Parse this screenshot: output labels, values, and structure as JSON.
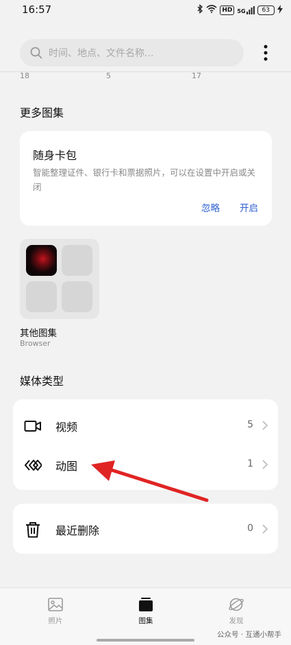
{
  "status": {
    "time": "16:57",
    "network": "5G",
    "hd": "HD",
    "battery": "63"
  },
  "search": {
    "placeholder": "时间、地点、文件名称..."
  },
  "scroll_counts": [
    "18",
    "5",
    "17"
  ],
  "more_albums": {
    "title": "更多图集",
    "wallet": {
      "title": "随身卡包",
      "description": "智能整理证件、银行卡和票据照片，可以在设置中开启或关闭",
      "ignore": "忽略",
      "enable": "开启"
    },
    "other": {
      "name": "其他图集",
      "sub": "Browser"
    }
  },
  "media_types": {
    "title": "媒体类型",
    "items": [
      {
        "label": "视频",
        "count": "5",
        "icon": "video-icon"
      },
      {
        "label": "动图",
        "count": "1",
        "icon": "animated-icon"
      }
    ]
  },
  "recently_deleted": {
    "label": "最近删除",
    "count": "0"
  },
  "tabs": [
    {
      "label": "照片",
      "icon": "photo-icon",
      "active": false
    },
    {
      "label": "图集",
      "icon": "album-icon",
      "active": true
    },
    {
      "label": "发现",
      "icon": "explore-icon",
      "active": false
    }
  ],
  "watermark": "公众号 · 互通小帮手",
  "colors": {
    "accent": "#2f5fd1",
    "arrow": "#e02424",
    "background": "#f2f2f2"
  }
}
